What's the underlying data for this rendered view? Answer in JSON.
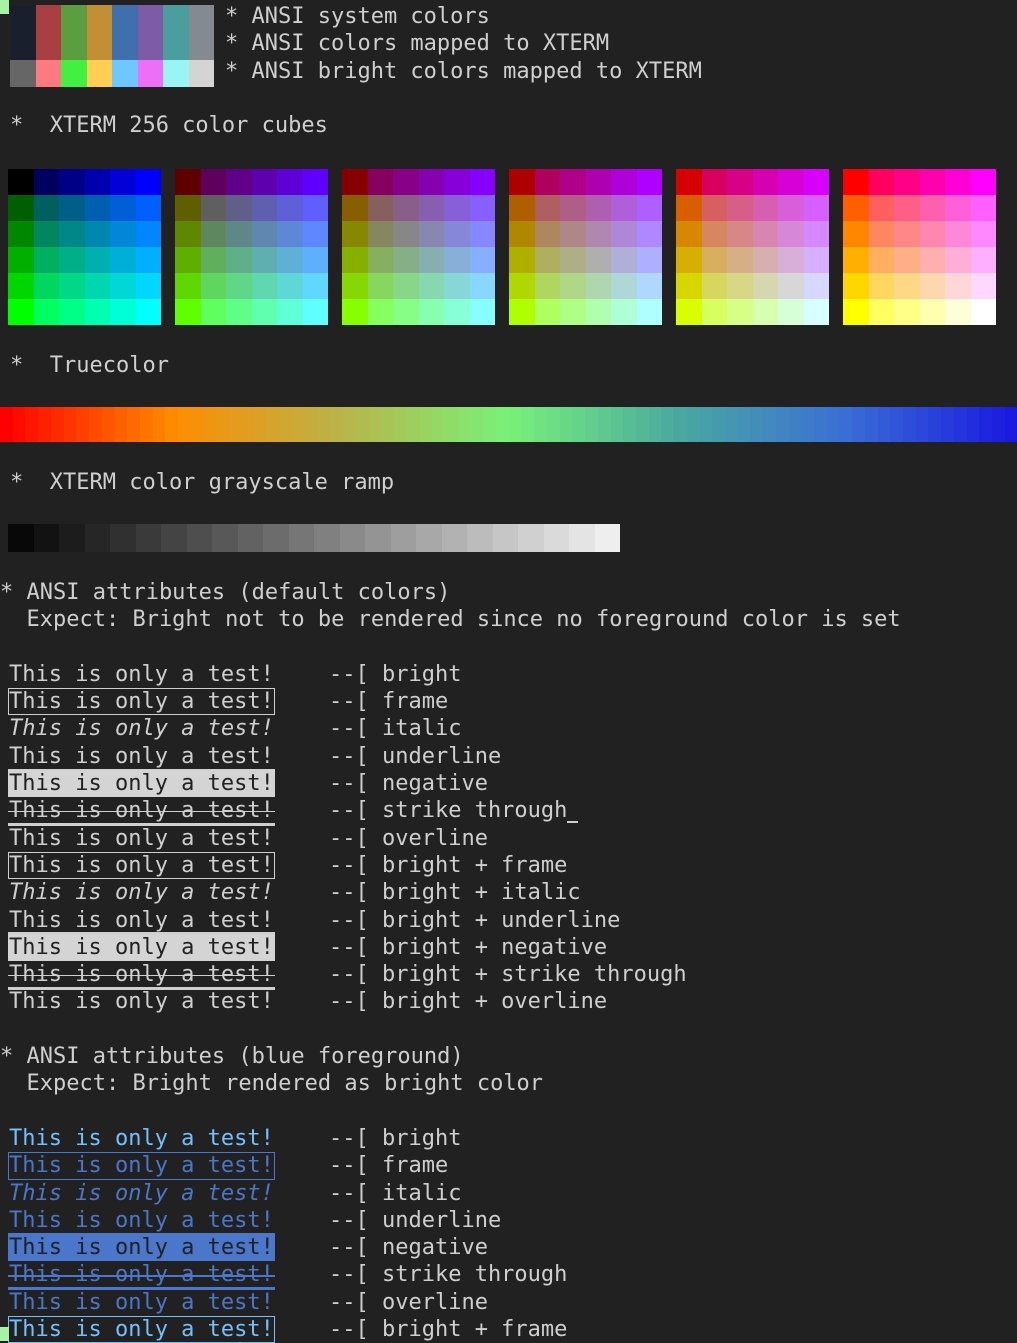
{
  "terminal": {
    "background": "#212121",
    "foreground": "#cfcfcf",
    "blue_fg": "#4a77c9",
    "bright_blue_fg": "#74c0ff",
    "negative_bg_default": "#d4d4d4",
    "cursor_color": "#a6f3a6"
  },
  "headings": {
    "ansi_system_colors": "* ANSI system colors",
    "ansi_mapped_xterm": "* ANSI colors mapped to XTERM",
    "ansi_bright_mapped_xterm": "* ANSI bright colors mapped to XTERM",
    "xterm_cubes": "*  XTERM 256 color cubes",
    "truecolor": "*  Truecolor",
    "grayscale_ramp": "*  XTERM color grayscale ramp",
    "attrs_default": "* ANSI attributes (default colors)",
    "attrs_default_expect": "  Expect: Bright not to be rendered since no foreground color is set",
    "attrs_blue": "* ANSI attributes (blue foreground)",
    "attrs_blue_expect": "  Expect: Bright rendered as bright color"
  },
  "sample_text": "This is only a test!",
  "separator": "--[",
  "ansi_system_row": [
    "#1a1f2e",
    "#a93f43",
    "#5a9e3f",
    "#c28f34",
    "#3f6fad",
    "#7d5ba6",
    "#4a9e9e",
    "#848b90"
  ],
  "ansi_bright_row": [
    "#666666",
    "#fd7b80",
    "#41f041",
    "#ffce52",
    "#6ec8ff",
    "#ee6ef7",
    "#99f4f4",
    "#d4d4d4"
  ],
  "cube_levels": [
    0,
    95,
    135,
    175,
    215,
    255
  ],
  "grayscale_levels": [
    8,
    18,
    28,
    38,
    48,
    58,
    68,
    78,
    88,
    98,
    108,
    118,
    128,
    138,
    148,
    158,
    168,
    178,
    188,
    198,
    208,
    218,
    228,
    238
  ],
  "truecolor_stops": [
    "#ff0000",
    "#ff8c00",
    "#b9b44a",
    "#79f179",
    "#4aa9a0",
    "#3b6fd4",
    "#1a1ae0"
  ],
  "attributes_default": [
    {
      "name": "bright",
      "label": "bright",
      "style": "bright"
    },
    {
      "name": "frame",
      "label": "frame",
      "style": "frame"
    },
    {
      "name": "italic",
      "label": "italic",
      "style": "italic"
    },
    {
      "name": "underline",
      "label": "underline",
      "style": "underline"
    },
    {
      "name": "negative",
      "label": "negative",
      "style": "negative"
    },
    {
      "name": "strike-through",
      "label": "strike through",
      "style": "strike"
    },
    {
      "name": "overline",
      "label": "overline",
      "style": "overline"
    },
    {
      "name": "bright-frame",
      "label": "bright + frame",
      "style": "frame"
    },
    {
      "name": "bright-italic",
      "label": "bright + italic",
      "style": "italic"
    },
    {
      "name": "bright-underline",
      "label": "bright + underline",
      "style": "underline"
    },
    {
      "name": "bright-negative",
      "label": "bright + negative",
      "style": "negative"
    },
    {
      "name": "bright-strike-through",
      "label": "bright + strike through",
      "style": "strike"
    },
    {
      "name": "bright-overline",
      "label": "bright + overline",
      "style": "overline"
    }
  ],
  "attributes_blue": [
    {
      "name": "bright",
      "label": "bright",
      "style": "bright"
    },
    {
      "name": "frame",
      "label": "frame",
      "style": "frame"
    },
    {
      "name": "italic",
      "label": "italic",
      "style": "italic"
    },
    {
      "name": "underline",
      "label": "underline",
      "style": "underline"
    },
    {
      "name": "negative",
      "label": "negative",
      "style": "negative"
    },
    {
      "name": "strike-through",
      "label": "strike through",
      "style": "strike"
    },
    {
      "name": "overline",
      "label": "overline",
      "style": "overline"
    },
    {
      "name": "bright-frame",
      "label": "bright + frame",
      "style": "frame-bright"
    }
  ]
}
